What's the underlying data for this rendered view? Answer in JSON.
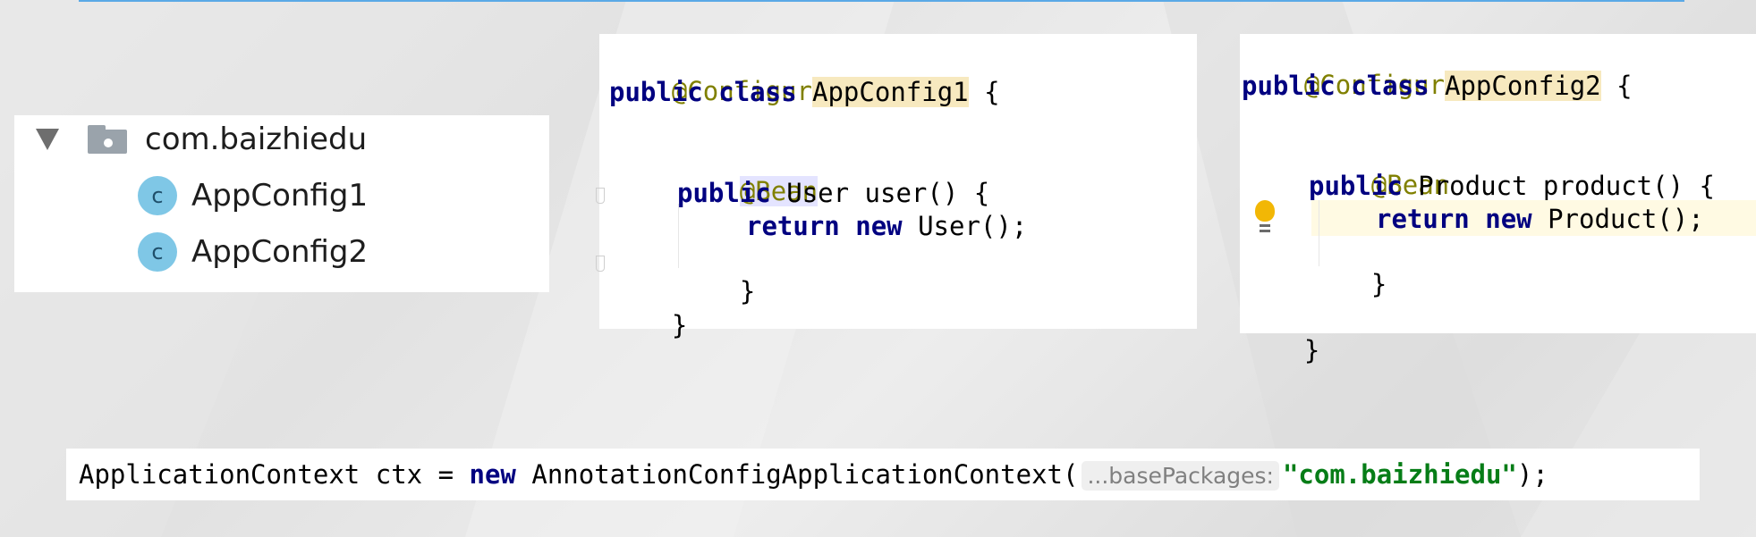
{
  "tree": {
    "package_name": "com.baizhiedu",
    "class_icon_letter": "c",
    "classes": [
      "AppConfig1",
      "AppConfig2"
    ]
  },
  "config1": {
    "annotation": "@Configuration",
    "kw_public": "public",
    "kw_class": "class",
    "class_name": "AppConfig1",
    "open_brace": "{",
    "bean_annotation": "@Bean",
    "method_return_type": "User",
    "method_signature": "user() {",
    "kw_return": "return",
    "kw_new": "new",
    "constructor_call": "User();",
    "close_method": "}",
    "close_class": "}"
  },
  "config2": {
    "annotation": "@Configuration",
    "kw_public": "public",
    "kw_class": "class",
    "class_name": "AppConfig2",
    "open_brace": "{",
    "bean_annotation": "@Bean",
    "method_return_type": "Product",
    "method_signature": "product() {",
    "kw_return": "return",
    "kw_new": "new",
    "constructor_call": "Product();",
    "close_method": "}",
    "close_class": "}"
  },
  "context_line": {
    "declaration": "ApplicationContext ctx =",
    "kw_new": "new",
    "constructor": "AnnotationConfigApplicationContext(",
    "param_hint": "...basePackages:",
    "argument": "\"com.baizhiedu\"",
    "terminator": ");"
  },
  "colors": {
    "annotation": "#808000",
    "keyword": "#000080",
    "string": "#067d17",
    "highlight": "#f7e9bf",
    "class_icon": "#7fc7e6",
    "accent_rule": "#5aa9e6"
  },
  "icons": [
    "triangle-down-icon",
    "package-folder-icon",
    "class-icon",
    "lightbulb-icon"
  ]
}
